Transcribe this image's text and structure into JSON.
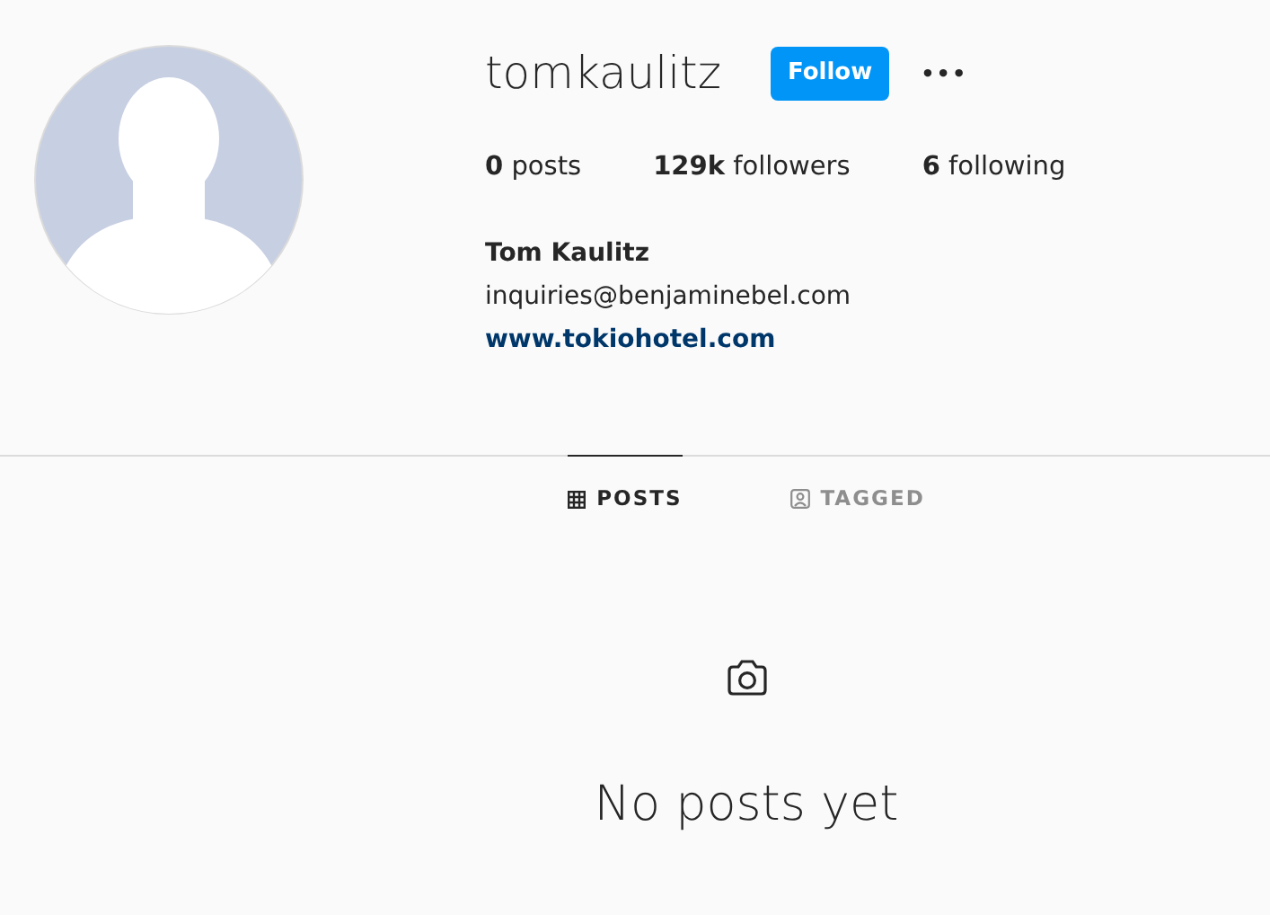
{
  "profile": {
    "username": "tomkaulitz",
    "follow_button": "Follow",
    "more_icon": "•••",
    "stats": [
      "**0** posts",
      "**129k** followers",
      "**6** following"
    ],
    "full_name": "Tom Kaulitz",
    "bio": "inquiries@benjaminebel.com",
    "website": "www.tokiohotel.com"
  },
  "tabs": [
    {
      "label": "POSTS",
      "kind": "grid",
      "selected": true
    },
    {
      "label": "TAGGED",
      "kind": "tagged",
      "selected": false
    }
  ],
  "empty_state": {
    "message": "No posts yet"
  }
}
